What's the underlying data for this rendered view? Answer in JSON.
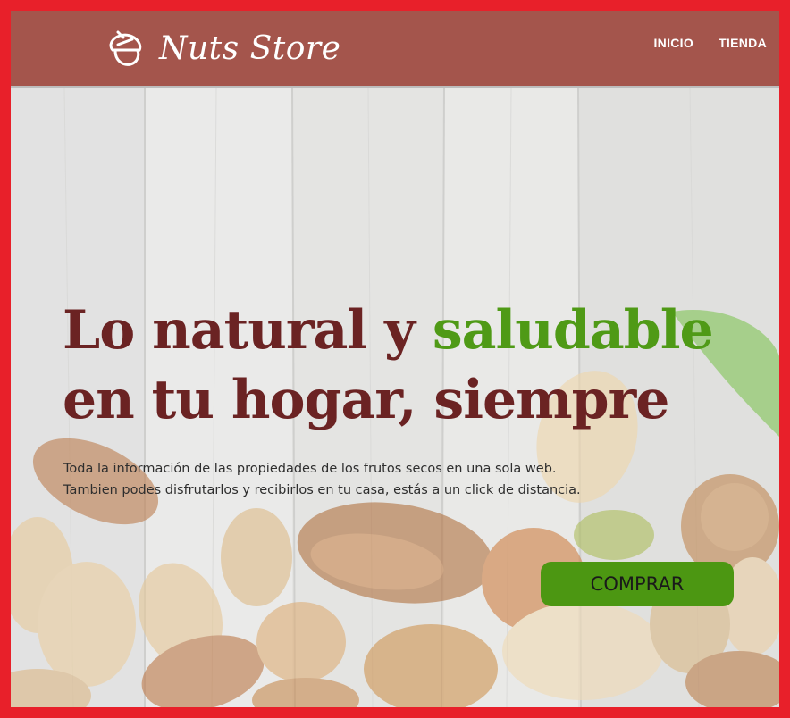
{
  "brand": {
    "name": "Nuts Store",
    "logo_icon": "acorn-icon"
  },
  "nav": {
    "items": [
      {
        "label": "INICIO"
      },
      {
        "label": "TIENDA"
      }
    ]
  },
  "hero": {
    "headline_part1": "Lo natural y ",
    "headline_accent": "saludable",
    "headline_part2": " en tu hogar, siempre",
    "description_line1": "Toda la información de las propiedades de los frutos secos en una sola web.",
    "description_line2": "Tambien podes disfrutarlos y recibirlos en tu casa, estás a un click de distancia.",
    "cta_label": "COMPRAR"
  },
  "colors": {
    "header_bg": "#a4554c",
    "headline": "#6b2323",
    "accent": "#4f9a16",
    "cta_bg": "#4c9712",
    "page_border": "#e8202a"
  }
}
